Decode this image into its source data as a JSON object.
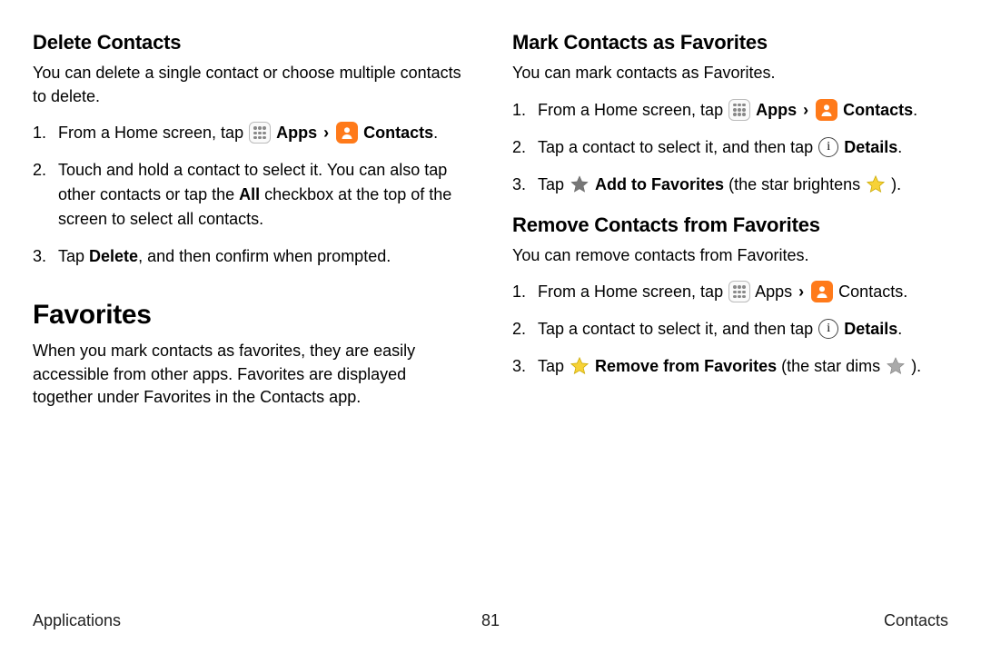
{
  "left": {
    "h_delete": "Delete Contacts",
    "p_delete": "You can delete a single contact or choose multiple contacts to delete.",
    "s1_a": "From a Home screen, tap ",
    "apps_lbl": "Apps",
    "contacts_lbl": "Contacts",
    "s2_a": "Touch and hold a contact to select it. You can also tap other contacts or tap the ",
    "s2_b": "All",
    "s2_c": " checkbox at the top of the screen to select all contacts.",
    "s3_a": "Tap ",
    "s3_b": "Delete",
    "s3_c": ", and then confirm when prompted.",
    "h_fav": "Favorites",
    "p_fav": "When you mark contacts as favorites, they are easily accessible from other apps. Favorites are displayed together under Favorites in the Contacts app."
  },
  "right": {
    "h_mark": "Mark Contacts as Favorites",
    "p_mark": "You can mark contacts as Favorites.",
    "s1_a": "From a Home screen, tap ",
    "apps_lbl": "Apps",
    "contacts_lbl": "Contacts",
    "s2_a": "Tap a contact to select it, and then tap ",
    "details_lbl": "Details",
    "s3_a": "Tap ",
    "s3_b": "Add to Favorites",
    "s3_c": " (the star brightens ",
    "s3_d": ").",
    "h_rem": "Remove Contacts from Favorites",
    "p_rem": "You can remove contacts from Favorites.",
    "r1_a": "From a Home screen, tap ",
    "apps_lbl2": "Apps",
    "contacts_lbl2": "Contacts",
    "r2_a": "Tap a contact to select it, and then tap ",
    "r3_a": "Tap ",
    "r3_b": "Remove from Favorites",
    "r3_c": " (the star dims ",
    "r3_d": ")."
  },
  "footer": {
    "left": "Applications",
    "center": "81",
    "right": "Contacts"
  },
  "glyphs": {
    "chev": "›",
    "period": "."
  }
}
